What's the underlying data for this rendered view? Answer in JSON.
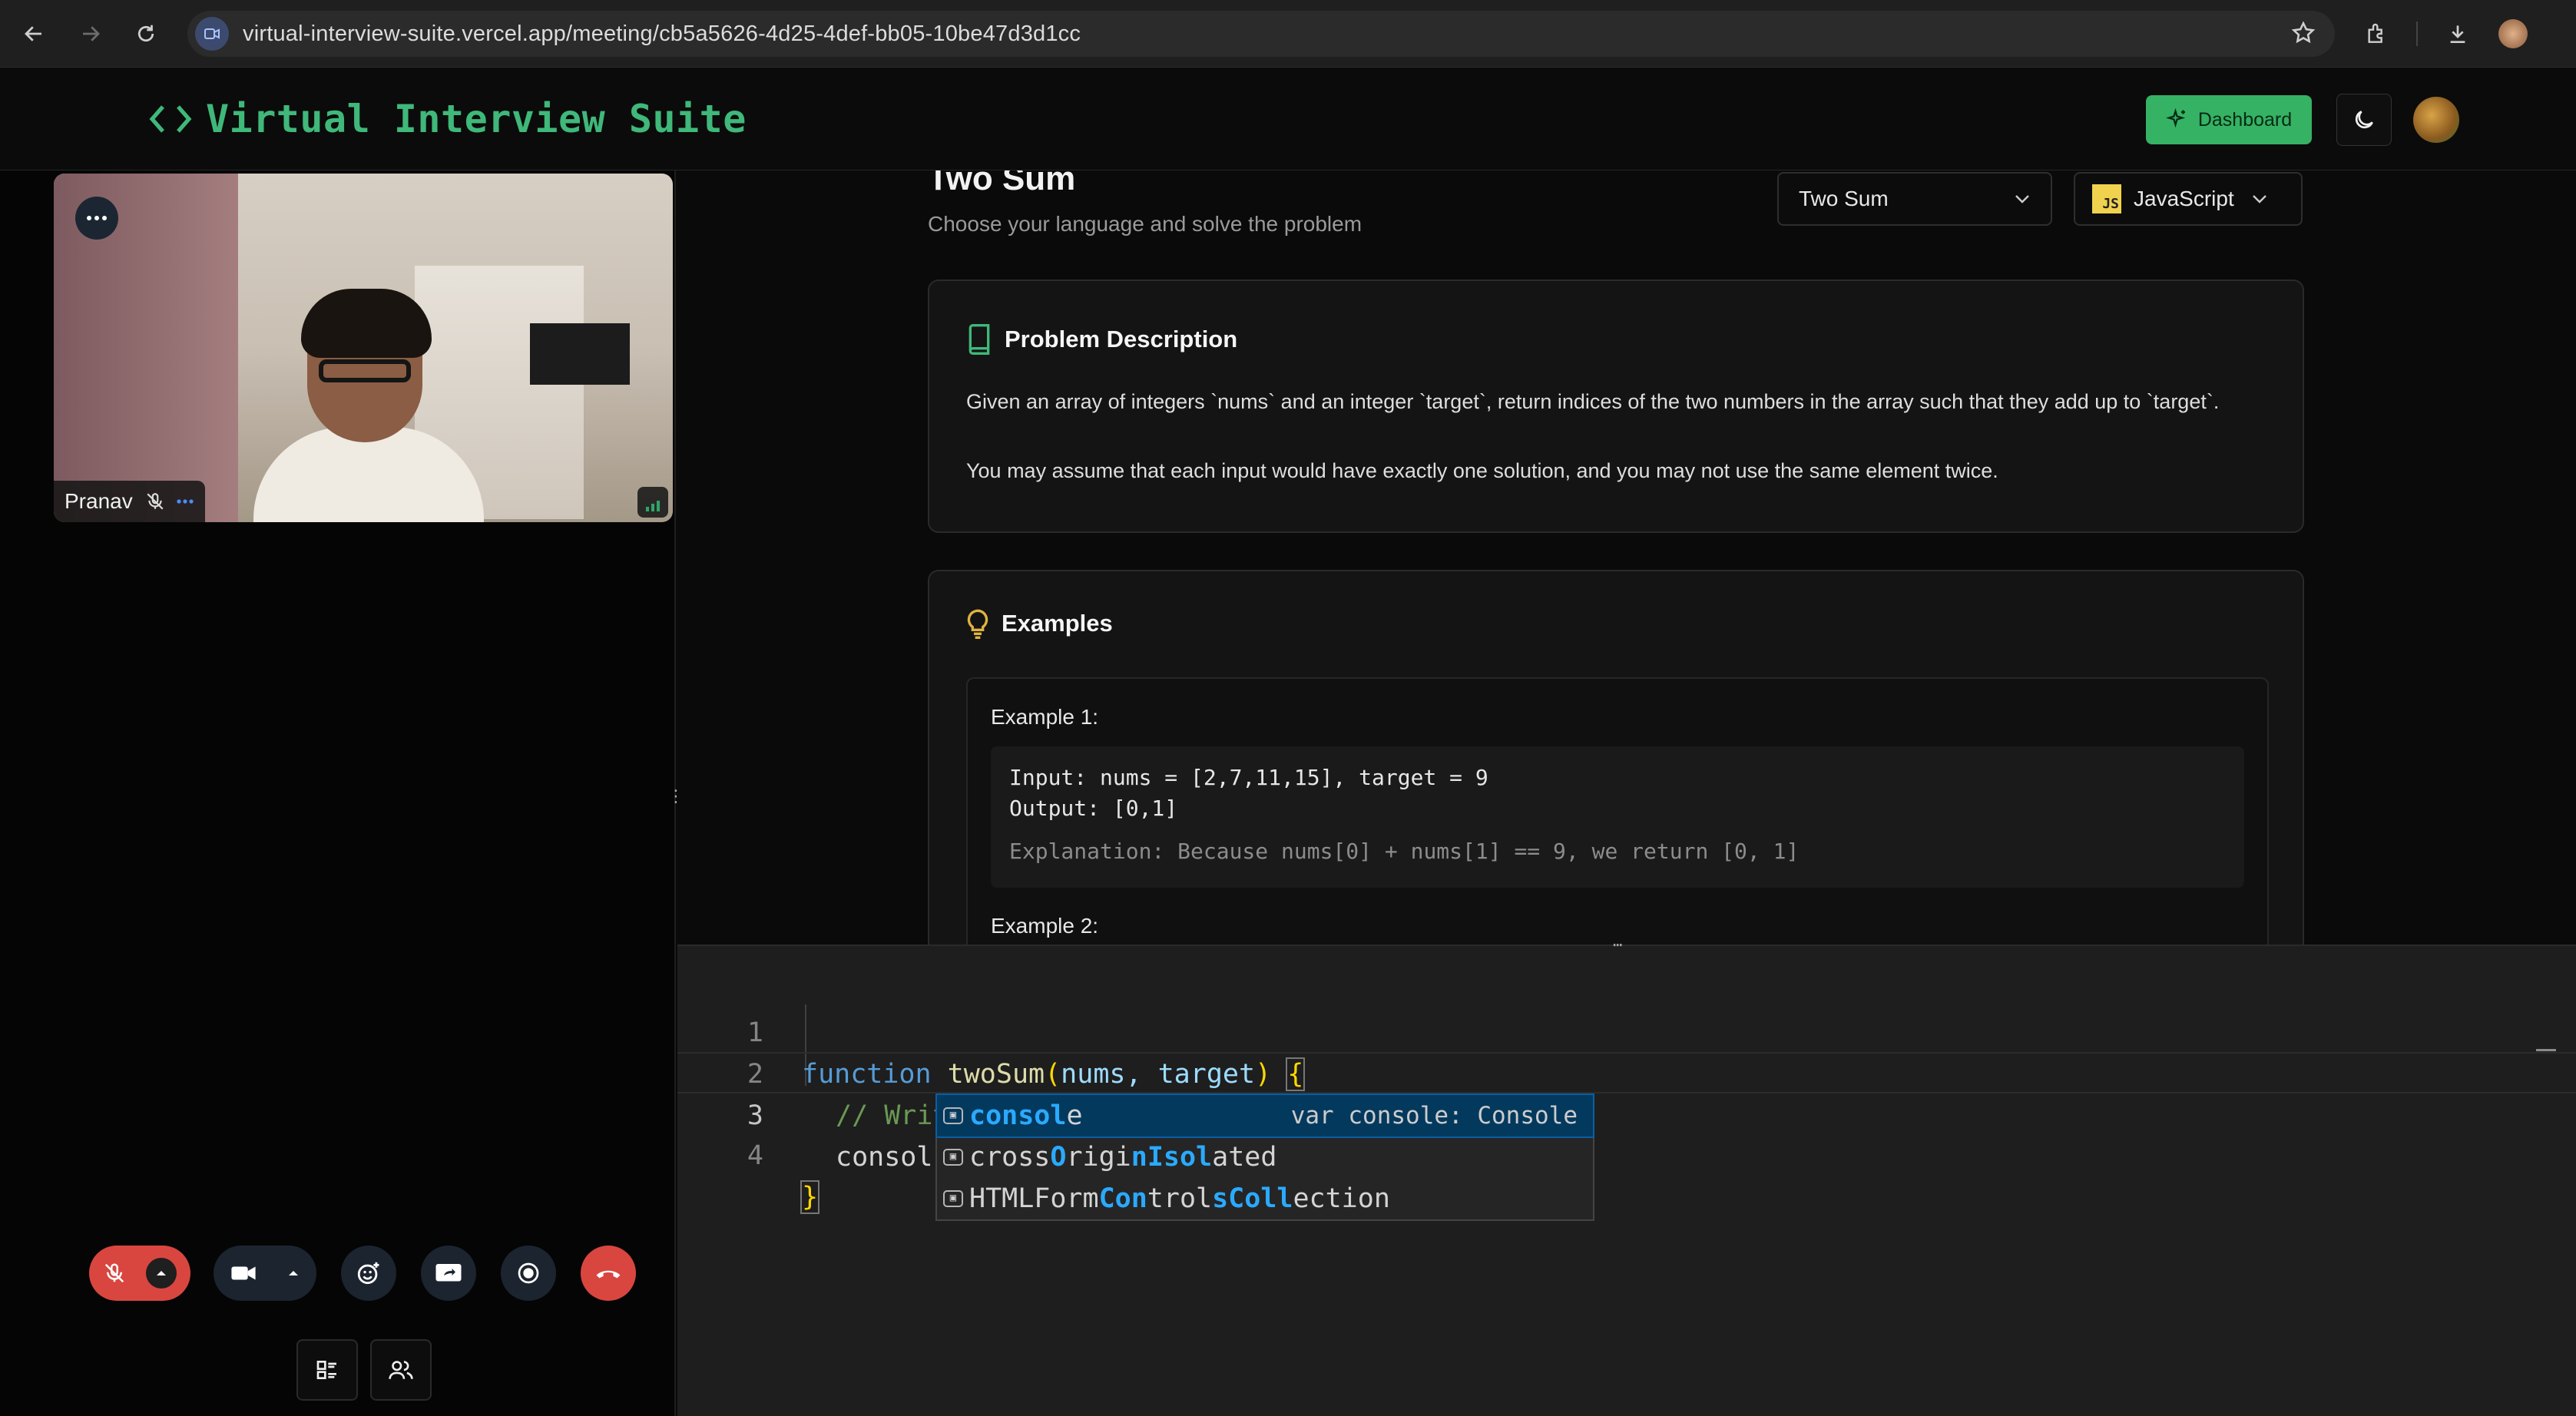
{
  "browser": {
    "url": "virtual-interview-suite.vercel.app/meeting/cb5a5626-4d25-4def-bb05-10be47d3d1cc"
  },
  "header": {
    "brand": "Virtual Interview Suite",
    "dashboard_label": "Dashboard"
  },
  "video": {
    "participant_name": "Pranav"
  },
  "problem": {
    "title": "Two Sum",
    "subtitle": "Choose your language and solve the problem",
    "problem_select": "Two Sum",
    "language_badge": "JS",
    "language_select": "JavaScript"
  },
  "description": {
    "heading": "Problem Description",
    "para1": "Given an array of integers `nums` and an integer `target`, return indices of the two numbers in the array such that they add up to `target`.",
    "para2": "You may assume that each input would have exactly one solution, and you may not use the same element twice."
  },
  "examples": {
    "heading": "Examples",
    "ex1_label": "Example 1:",
    "ex1_input": "Input: nums = [2,7,11,15], target = 9",
    "ex1_output": "Output: [0,1]",
    "ex1_explanation": "Explanation: Because nums[0] + nums[1] == 9, we return [0, 1]",
    "ex2_label": "Example 2:"
  },
  "editor": {
    "line_numbers": [
      "1",
      "2",
      "3",
      "4"
    ],
    "line1": {
      "keyword": "function",
      "name": "twoSum",
      "params": "nums, target"
    },
    "line2": "// Write your solution here",
    "line3": "consol",
    "line4": "}"
  },
  "suggestions": {
    "items": [
      {
        "pre": "",
        "hl": "consol",
        "post": "e",
        "detail": "var console: Console"
      },
      {
        "parts": [
          "cross",
          "O",
          "rigi",
          "n",
          "I",
          "so",
          "l",
          "ated"
        ]
      },
      {
        "parts": [
          "HTMLForm",
          "Con",
          "trol",
          "s",
          "Col",
          "l",
          "ection"
        ]
      }
    ]
  },
  "colors": {
    "brand_green": "#3fb87a",
    "dashboard_bg": "#36b264",
    "end_call_red": "#d9463f",
    "suggest_selected": "#04395e"
  }
}
